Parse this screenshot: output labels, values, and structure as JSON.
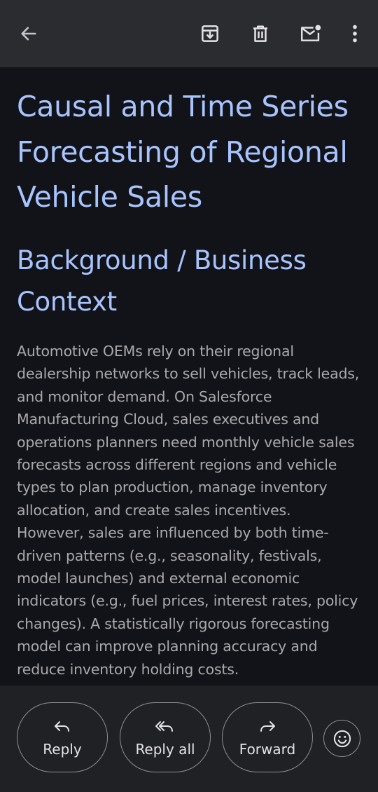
{
  "toolbar": {
    "icons": [
      "back-arrow-icon",
      "archive-icon",
      "delete-icon",
      "mark-unread-icon",
      "more-options-icon"
    ]
  },
  "email": {
    "title": "Causal and Time Series Forecasting of Regional Vehicle Sales",
    "section_heading": "Background / Business Context",
    "body": "Automotive OEMs rely on their regional dealership networks to sell vehicles, track leads, and monitor demand. On Salesforce Manufacturing Cloud, sales executives and operations planners need monthly vehicle sales forecasts across different regions and vehicle types to plan production, manage inventory allocation, and create sales incentives. However, sales are influenced by both time-driven patterns (e.g., seasonality, festivals, model launches) and external economic indicators (e.g., fuel prices, interest rates, policy changes). A statistically rigorous forecasting model can improve planning accuracy and reduce inventory holding costs."
  },
  "actions": {
    "reply_label": "Reply",
    "reply_all_label": "Reply all",
    "forward_label": "Forward",
    "emoji_icon": "emoji-reaction-icon"
  },
  "colors": {
    "heading": "#a8c4ff",
    "body_text": "#a9a9ad",
    "topbar_bg": "#2b2c30",
    "content_bg": "#121318",
    "bottombar_bg": "#202124"
  }
}
